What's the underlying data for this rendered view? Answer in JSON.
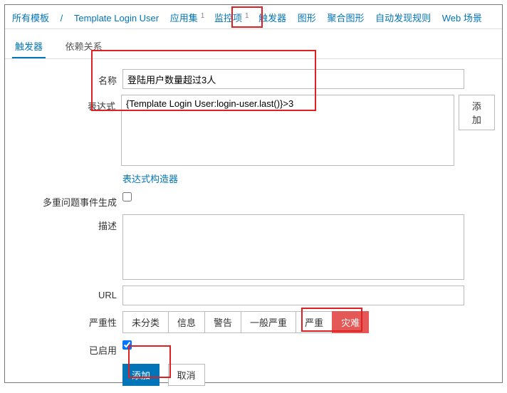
{
  "breadcrumb": {
    "root": "所有模板",
    "template": "Template Login User"
  },
  "topnav": {
    "apps": "应用集",
    "apps_count": "1",
    "items": "监控项",
    "items_count": "1",
    "triggers": "触发器",
    "graphs": "图形",
    "screens": "聚合图形",
    "discovery": "自动发现规则",
    "web": "Web 场景"
  },
  "subtabs": {
    "trigger": "触发器",
    "deps": "依赖关系"
  },
  "labels": {
    "name": "名称",
    "expression": "表达式",
    "add": "添加",
    "expr_builder": "表达式构造器",
    "multi_gen": "多重问题事件生成",
    "description": "描述",
    "url": "URL",
    "severity": "严重性",
    "enabled": "已启用"
  },
  "values": {
    "name": "登陆用户数量超过3人",
    "expression": "{Template Login User:login-user.last()}>3",
    "url": ""
  },
  "severity": {
    "s0": "未分类",
    "s1": "信息",
    "s2": "警告",
    "s3": "一般严重",
    "s4": "严重",
    "s5": "灾难"
  },
  "buttons": {
    "submit": "添加",
    "cancel": "取消"
  }
}
